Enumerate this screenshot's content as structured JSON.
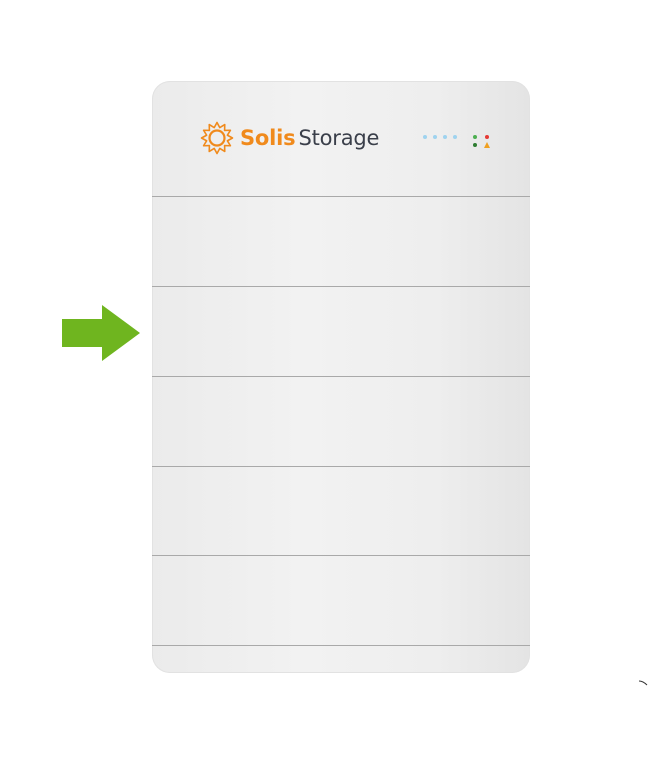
{
  "image": {
    "background": "#ffffff",
    "arrow": {
      "icon": "arrow-right-icon",
      "direction": "right",
      "color": "#6fb51f"
    },
    "battery": {
      "body_color": "#eeeeee",
      "divider_color": "#a9a9a9",
      "module_count": 6,
      "logo": {
        "icon": "sun-icon",
        "brand": "Solis",
        "sub": "Storage",
        "brand_color": "#f08a1c",
        "sub_color": "#3a3f4a"
      },
      "soc_leds": {
        "count": 4,
        "color": "#9fd3ef"
      },
      "status_leds": [
        {
          "icon": "led-green-icon",
          "color": "#4caf50"
        },
        {
          "icon": "led-red-icon",
          "color": "#e53935"
        },
        {
          "icon": "led-green-icon",
          "color": "#2e7d32"
        },
        {
          "icon": "warning-triangle-icon",
          "color": "#f0a020"
        }
      ]
    }
  }
}
